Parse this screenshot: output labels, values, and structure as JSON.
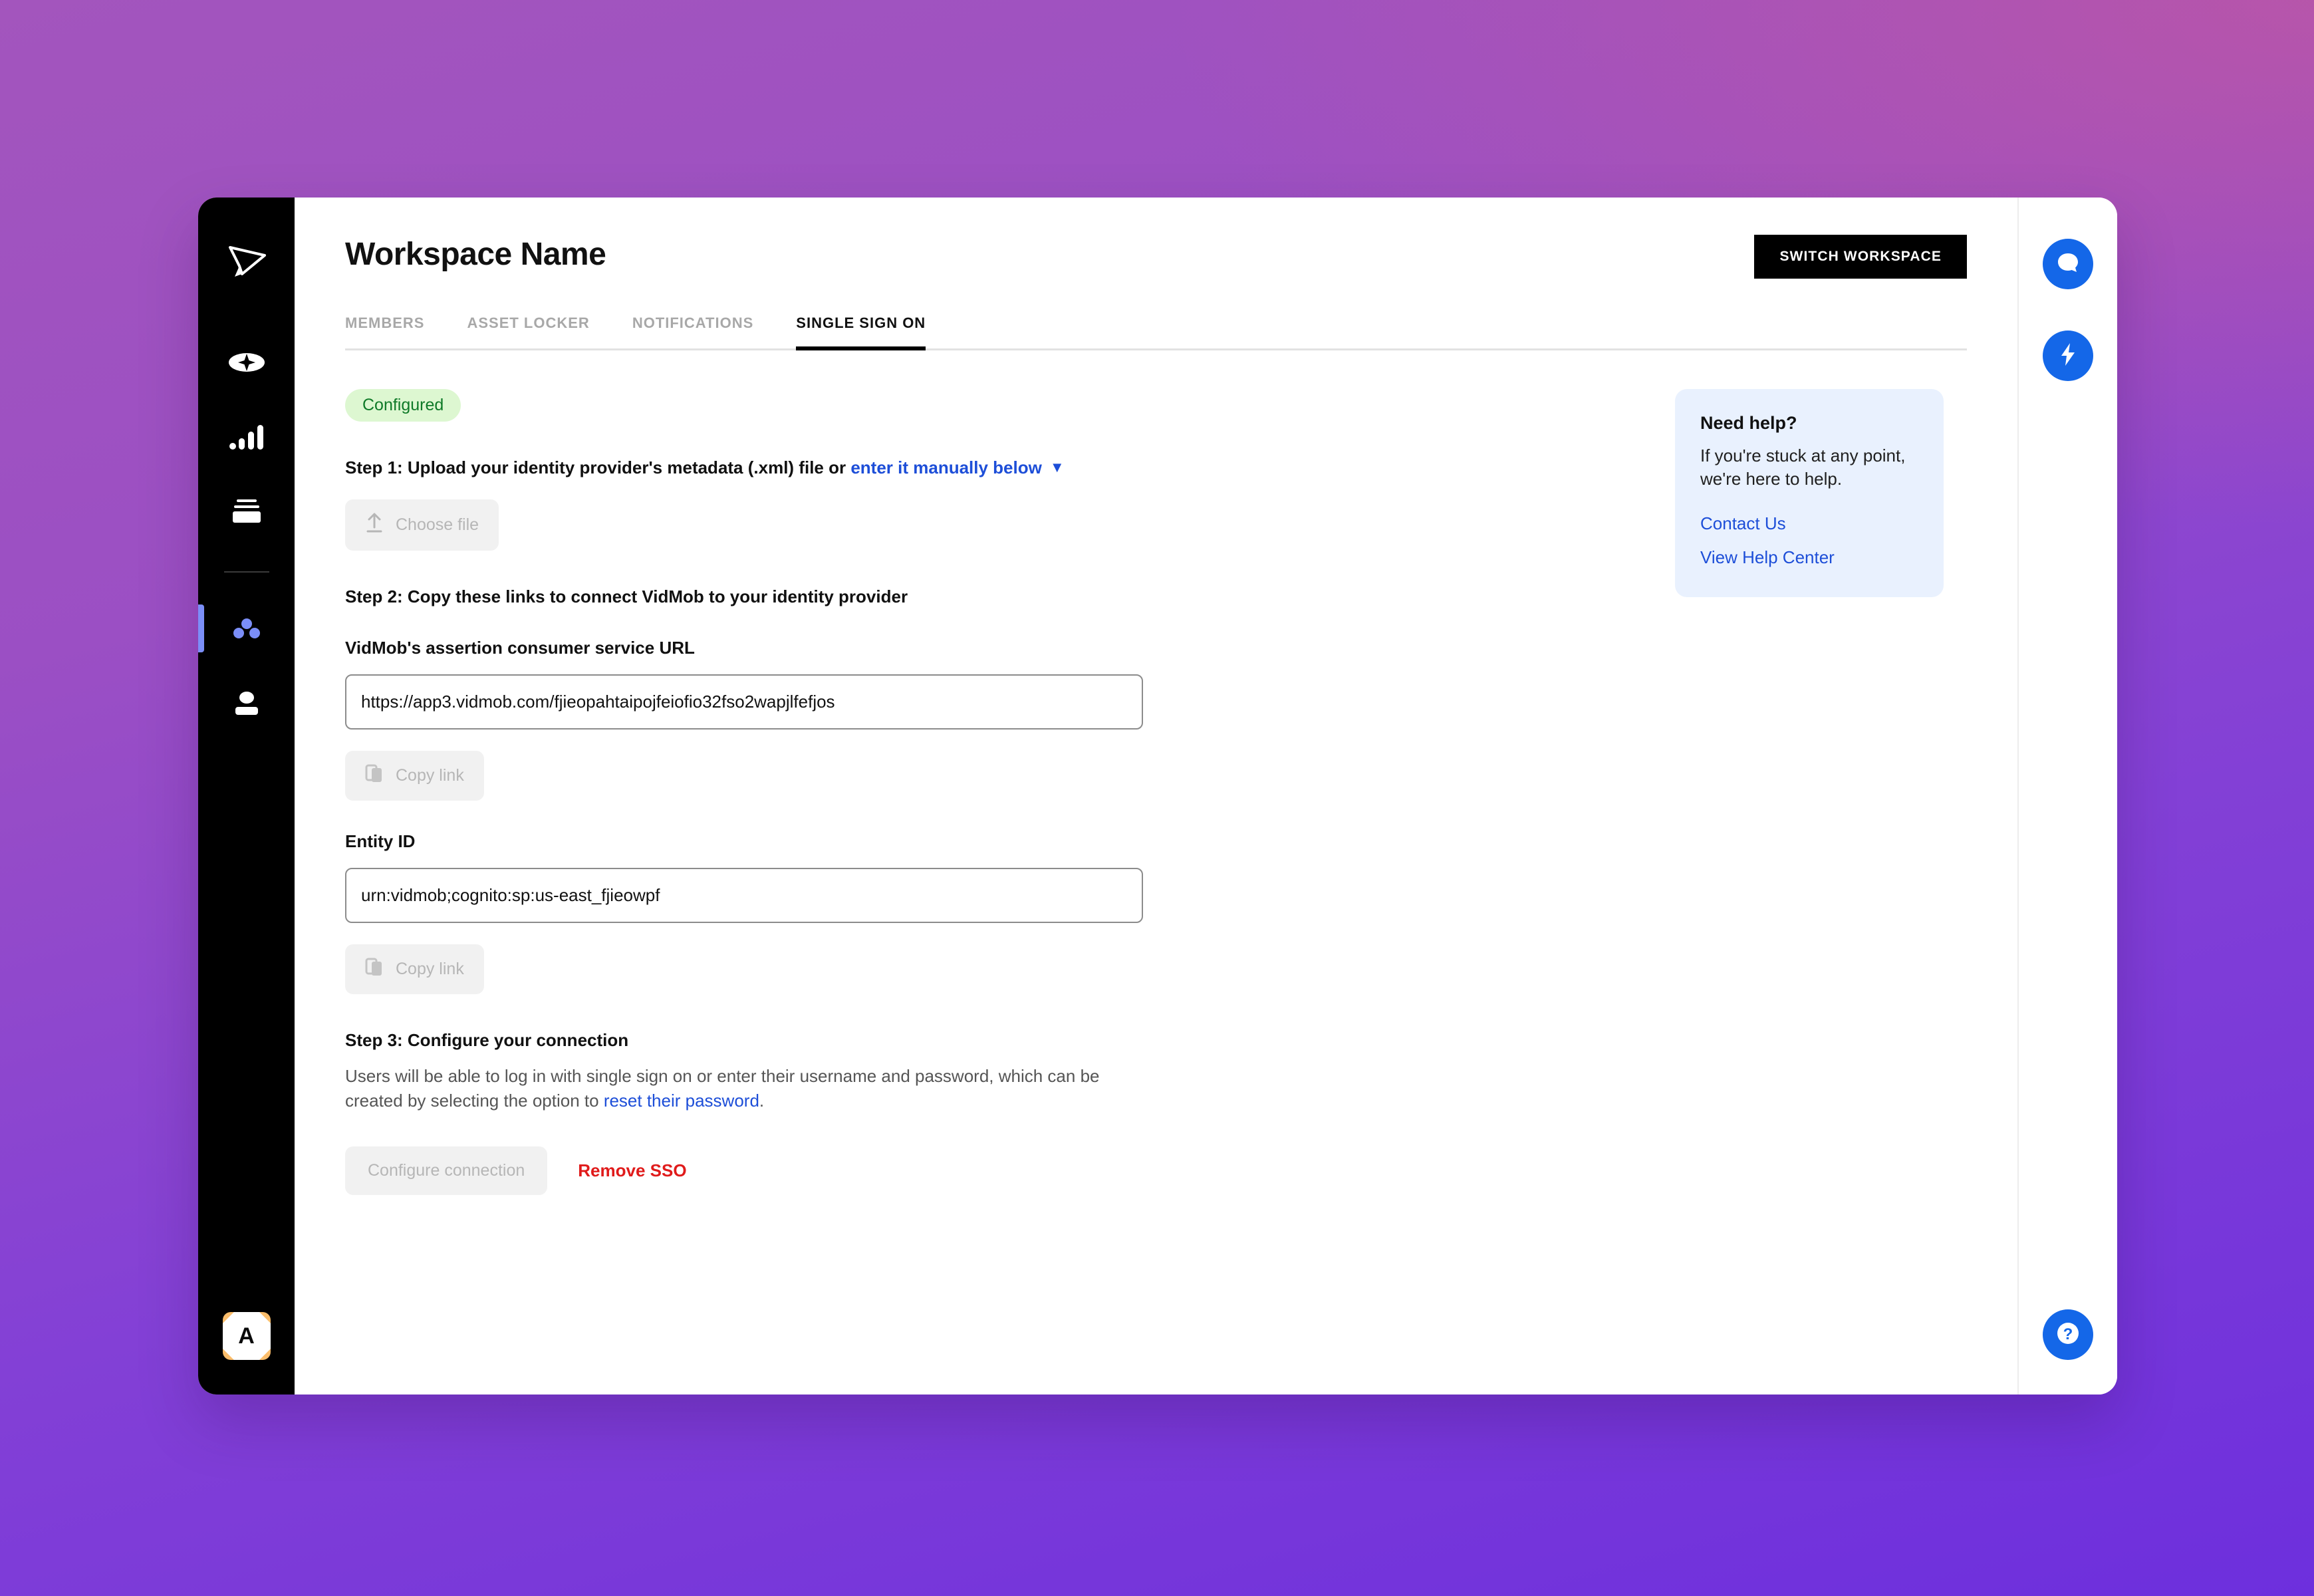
{
  "window": {
    "title": "Workspace Name"
  },
  "sidebar": {
    "logo_icon": "vidmob-cursor-logo",
    "items": [
      {
        "icon": "sparkle-icon",
        "name": "create"
      },
      {
        "icon": "bar-chart-icon",
        "name": "insights"
      },
      {
        "icon": "layers-stack-icon",
        "name": "library"
      },
      {
        "icon": "three-dots-cluster-icon",
        "name": "workspace-settings",
        "active": true
      },
      {
        "icon": "person-icon",
        "name": "account"
      }
    ],
    "avatar_letter": "A"
  },
  "header": {
    "switch_workspace_label": "SWITCH WORKSPACE"
  },
  "tabs": [
    {
      "label": "MEMBERS",
      "active": false
    },
    {
      "label": "ASSET LOCKER",
      "active": false
    },
    {
      "label": "NOTIFICATIONS",
      "active": false
    },
    {
      "label": "SINGLE SIGN ON",
      "active": true
    }
  ],
  "sso": {
    "status_badge": "Configured",
    "step1": {
      "text_before": "Step 1: Upload your identity provider's metadata (.xml) file or ",
      "link_label": "enter it manually below",
      "caret_icon": "chevron-down-icon",
      "choose_file_label": "Choose file",
      "upload_icon": "upload-arrow-icon"
    },
    "step2": {
      "heading": "Step 2: Copy these links to connect VidMob to your identity provider",
      "acs_label": "VidMob's assertion consumer service URL",
      "acs_value": "https://app3.vidmob.com/fjieopahtaipojfeiofio32fso2wapjlfefjos",
      "acs_copy_label": "Copy link",
      "entity_label": "Entity ID",
      "entity_value": "urn:vidmob;cognito:sp:us-east_fjieowpf",
      "entity_copy_label": "Copy link",
      "copy_icon": "copy-icon"
    },
    "step3": {
      "heading": "Step 3: Configure your connection",
      "desc_before": "Users will be able to log in with single sign on or enter their username and password, which can be created by selecting the option to ",
      "desc_link": "reset their password",
      "desc_after": ".",
      "configure_label": "Configure connection",
      "remove_label": "Remove SSO"
    }
  },
  "help_card": {
    "title": "Need help?",
    "body": "If you're stuck at any point, we're here to help.",
    "contact_label": "Contact Us",
    "help_center_label": "View Help Center"
  },
  "right_rail": {
    "chat_icon": "chat-bubble-icon",
    "bolt_icon": "lightning-bolt-icon",
    "help_icon": "question-mark-icon"
  },
  "colors": {
    "accent_blue": "#1d4ed8",
    "fab_blue": "#1467e8",
    "danger_red": "#e01b1b",
    "badge_green_bg": "#ddf7d1",
    "badge_green_fg": "#0f7a28",
    "nav_active": "#7b8ef7",
    "avatar_orange": "#fbbd6b"
  }
}
